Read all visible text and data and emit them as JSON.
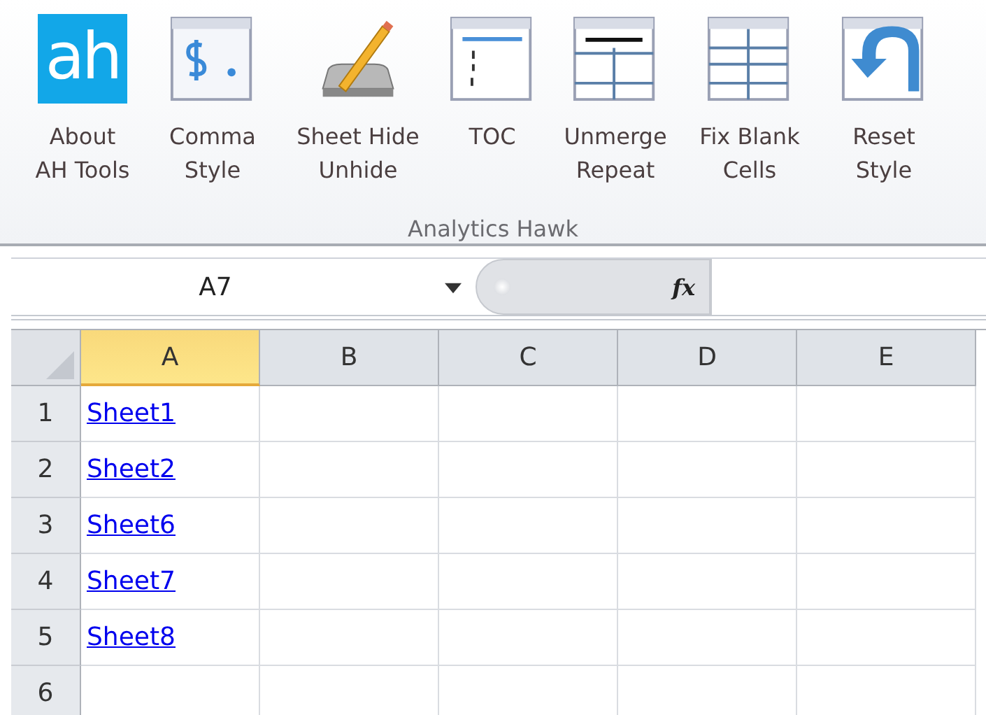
{
  "ribbon": {
    "buttons": [
      {
        "kind": "logo",
        "logo_text": "ah",
        "lines": [
          "About",
          "AH Tools"
        ]
      },
      {
        "kind": "comma",
        "lines": [
          "Comma",
          "Style"
        ]
      },
      {
        "kind": "pencil",
        "lines": [
          "Sheet Hide",
          "Unhide"
        ]
      },
      {
        "kind": "toc",
        "lines": [
          "TOC"
        ]
      },
      {
        "kind": "unmerge",
        "lines": [
          "Unmerge",
          "Repeat"
        ]
      },
      {
        "kind": "grid",
        "lines": [
          "Fix Blank",
          "Cells"
        ]
      },
      {
        "kind": "reset",
        "lines": [
          "Reset",
          "Style"
        ]
      }
    ],
    "group_label": "Analytics Hawk"
  },
  "formula_bar": {
    "name_box": "A7",
    "fx": "fx"
  },
  "sheet": {
    "columns": [
      {
        "label": "A",
        "selected": true
      },
      {
        "label": "B",
        "selected": false
      },
      {
        "label": "C",
        "selected": false
      },
      {
        "label": "D",
        "selected": false
      },
      {
        "label": "E",
        "selected": false
      }
    ],
    "rows": [
      {
        "number": "1",
        "link": "Sheet1"
      },
      {
        "number": "2",
        "link": "Sheet2"
      },
      {
        "number": "3",
        "link": "Sheet6"
      },
      {
        "number": "4",
        "link": "Sheet7"
      },
      {
        "number": "5",
        "link": "Sheet8"
      },
      {
        "number": "6"
      }
    ]
  }
}
